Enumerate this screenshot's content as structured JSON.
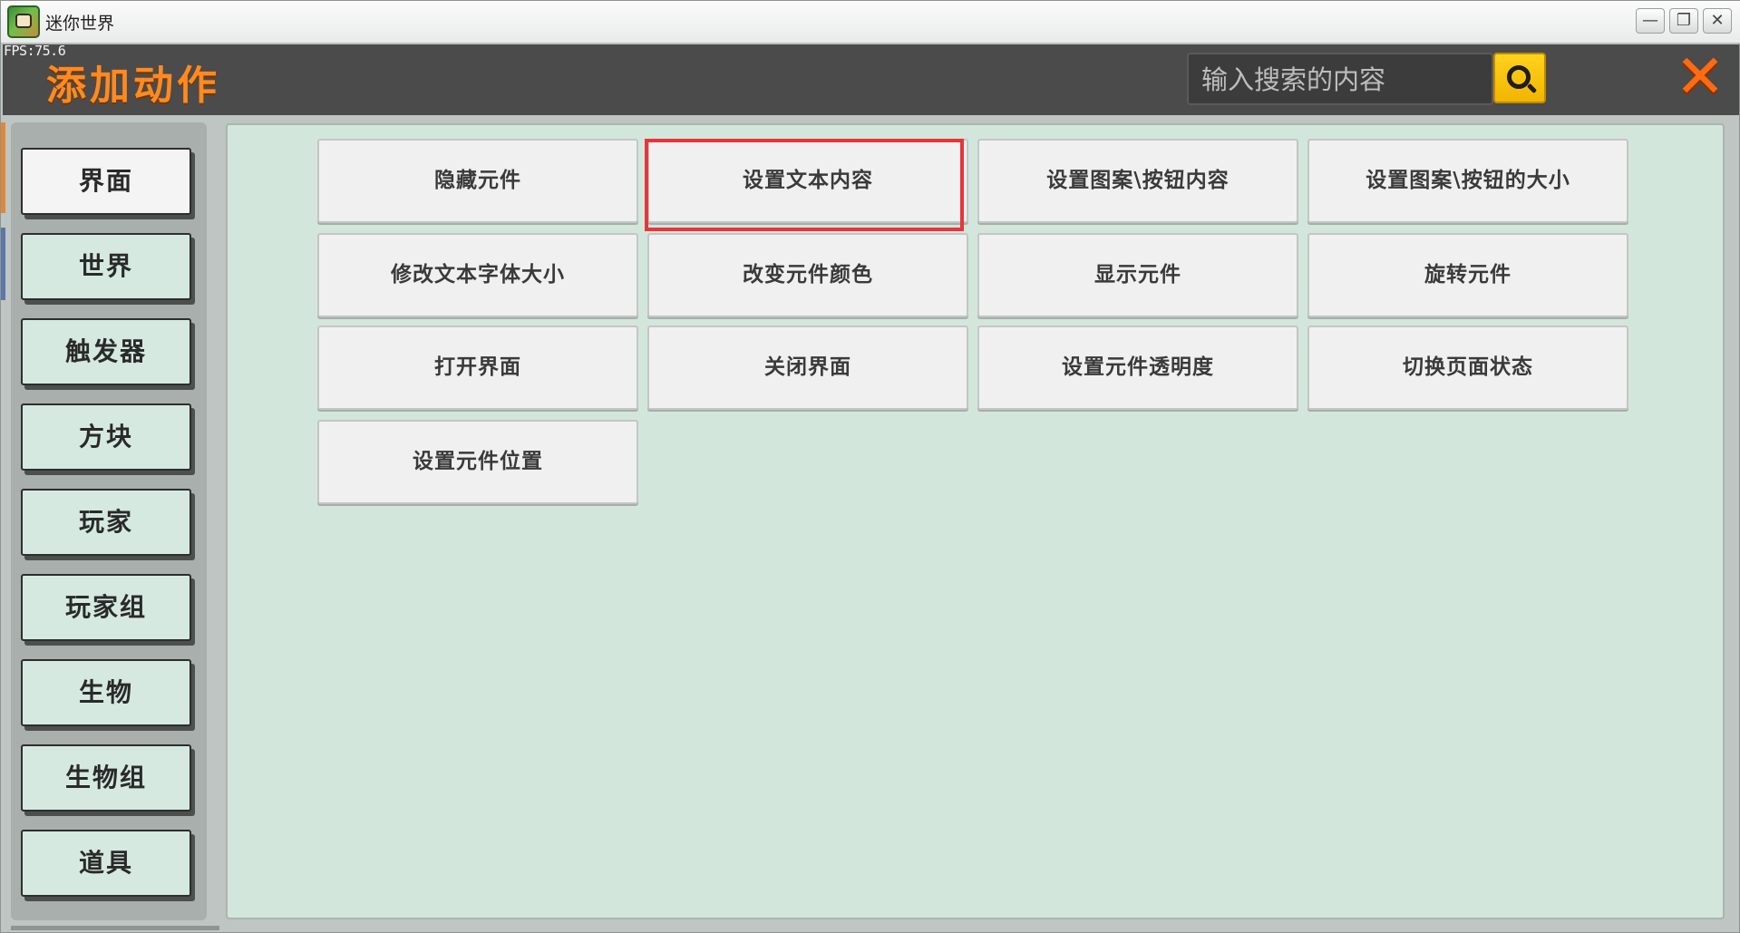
{
  "window": {
    "title": "迷你世界",
    "fps": "FPS:75.6",
    "minimize_icon": "minimize-icon",
    "maximize_icon": "restore-icon",
    "close_icon": "close-icon"
  },
  "header": {
    "title": "添加动作",
    "search_placeholder": "输入搜索的内容",
    "search_icon": "search-icon",
    "close_icon": "close-x-icon",
    "accent_color": "#ff8a1f"
  },
  "sidebar": {
    "items": [
      {
        "label": "界面",
        "active": true
      },
      {
        "label": "世界",
        "active": false
      },
      {
        "label": "触发器",
        "active": false
      },
      {
        "label": "方块",
        "active": false
      },
      {
        "label": "玩家",
        "active": false
      },
      {
        "label": "玩家组",
        "active": false
      },
      {
        "label": "生物",
        "active": false
      },
      {
        "label": "生物组",
        "active": false
      },
      {
        "label": "道具",
        "active": false
      }
    ]
  },
  "actions": {
    "items": [
      {
        "label": "隐藏元件"
      },
      {
        "label": "设置文本内容",
        "highlighted": true
      },
      {
        "label": "设置图案\\按钮内容"
      },
      {
        "label": "设置图案\\按钮的大小"
      },
      {
        "label": "修改文本字体大小"
      },
      {
        "label": "改变元件颜色"
      },
      {
        "label": "显示元件"
      },
      {
        "label": "旋转元件"
      },
      {
        "label": "打开界面"
      },
      {
        "label": "关闭界面"
      },
      {
        "label": "设置元件透明度"
      },
      {
        "label": "切换页面状态"
      },
      {
        "label": "设置元件位置"
      }
    ],
    "highlight_color": "#e8343a"
  }
}
